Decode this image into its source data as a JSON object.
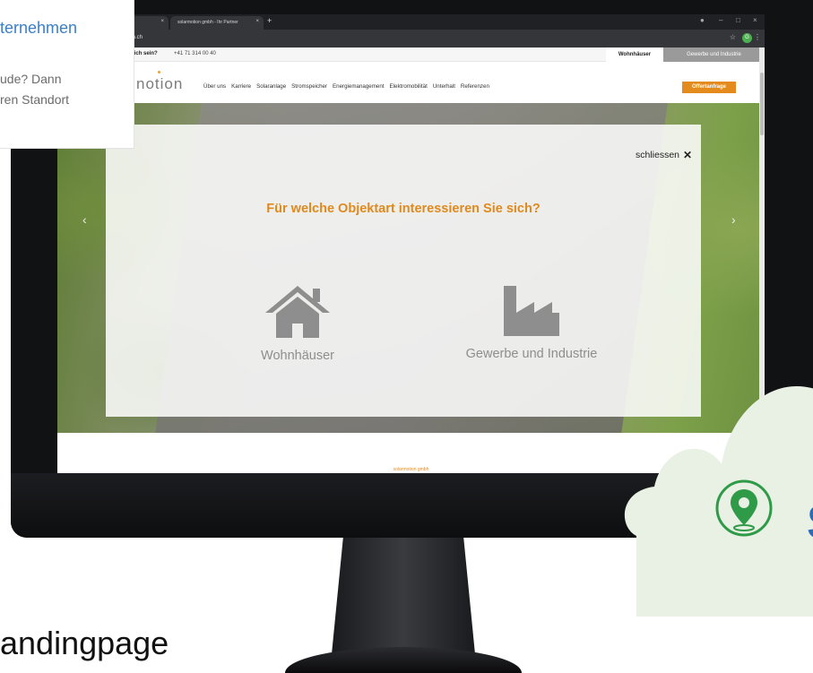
{
  "overlay_card": {
    "title": "ternehmen",
    "lines": [
      "ude? Dann",
      "ren Standort"
    ]
  },
  "browser": {
    "tabs": [
      {
        "label": "",
        "close": "×"
      },
      {
        "label": "solarmotion gmbh - Ihr Partner",
        "close": "×"
      }
    ],
    "new_tab": "+",
    "url": "otion.ch",
    "controls": [
      "●",
      "–",
      "□",
      "×"
    ],
    "bookmark_star": "☆",
    "profile_initial": "G",
    "menu": "⋮"
  },
  "site": {
    "topbar": {
      "question": "lfich sein?",
      "phone": "+41 71 314 00 40",
      "segments": [
        "Wohnhäuser",
        "Gewerbe und Industrie"
      ]
    },
    "logo": "notion",
    "nav": [
      "Über uns",
      "Karriere",
      "Solaranlage",
      "Stromspeicher",
      "Energiemanagement",
      "Elektromobilität",
      "Unterhalt",
      "Referenzen"
    ],
    "cta": "Offertanfrage",
    "hero_arrows": [
      "‹",
      "›"
    ],
    "footer_brand": "solarmotion gmbh"
  },
  "modal": {
    "close_label": "schliessen",
    "close_icon": "✕",
    "title": "Für welche Objektart interessieren Sie sich?",
    "options": [
      {
        "label": "Wohnhäuser",
        "icon": "house-icon"
      },
      {
        "label": "Gewerbe und Industrie",
        "icon": "factory-icon"
      }
    ]
  },
  "cloud": {
    "letter": "S",
    "icon": "map-pin-icon"
  },
  "bottom_label": "andingpage",
  "colors": {
    "accent_orange": "#e08a1d",
    "link_blue": "#3a7fc7",
    "pin_green": "#2f9a47",
    "cloud_bg": "#e8f1e4",
    "option_grey": "#8e8e8e"
  }
}
